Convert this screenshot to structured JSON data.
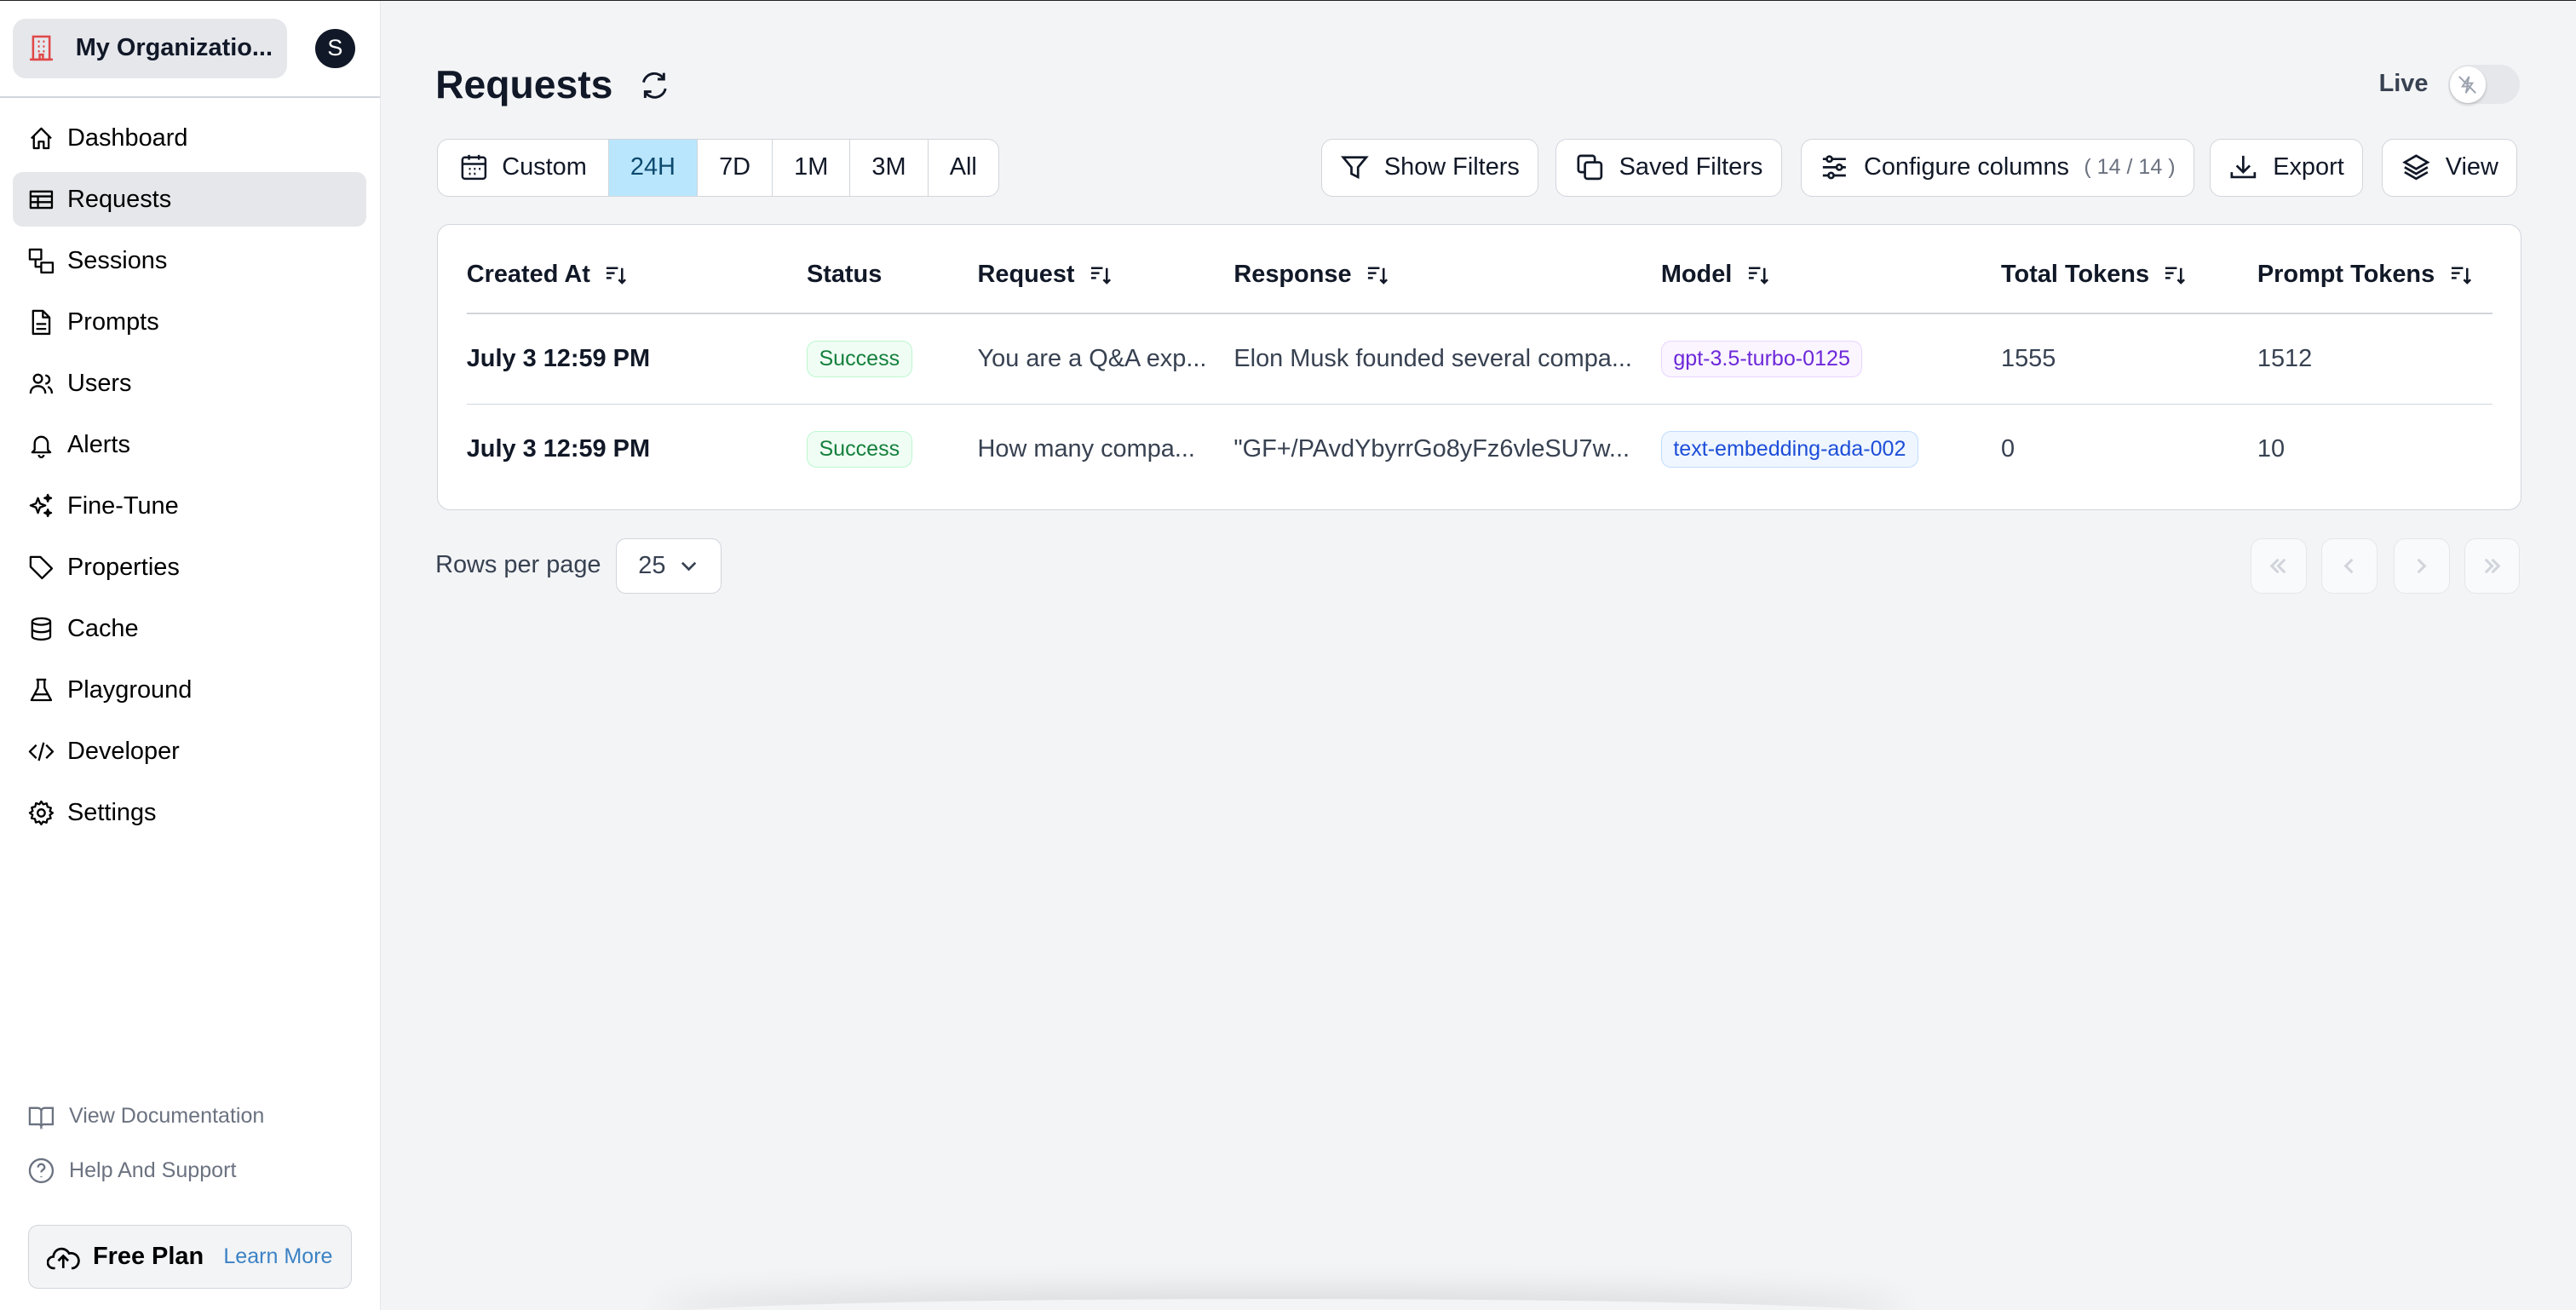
{
  "sidebar": {
    "org_name": "My Organizatio...",
    "avatar_initial": "S",
    "items": [
      {
        "label": "Dashboard",
        "icon": "home-icon"
      },
      {
        "label": "Requests",
        "icon": "table-icon",
        "active": true
      },
      {
        "label": "Sessions",
        "icon": "sessions-icon"
      },
      {
        "label": "Prompts",
        "icon": "document-icon"
      },
      {
        "label": "Users",
        "icon": "users-icon"
      },
      {
        "label": "Alerts",
        "icon": "bell-icon"
      },
      {
        "label": "Fine-Tune",
        "icon": "sparkles-icon"
      },
      {
        "label": "Properties",
        "icon": "tag-icon"
      },
      {
        "label": "Cache",
        "icon": "database-icon"
      },
      {
        "label": "Playground",
        "icon": "beaker-icon"
      },
      {
        "label": "Developer",
        "icon": "code-icon"
      },
      {
        "label": "Settings",
        "icon": "gear-icon"
      }
    ],
    "footer": {
      "docs": "View Documentation",
      "help": "Help And Support",
      "plan": "Free Plan",
      "learn_more": "Learn More"
    }
  },
  "header": {
    "title": "Requests",
    "live_label": "Live",
    "live_on": false
  },
  "toolbar": {
    "ranges": [
      "Custom",
      "24H",
      "7D",
      "1M",
      "3M",
      "All"
    ],
    "selected_range": "24H",
    "show_filters": "Show Filters",
    "saved_filters": "Saved Filters",
    "configure_columns": "Configure columns",
    "columns_count": "( 14 / 14 )",
    "export": "Export",
    "view": "View"
  },
  "table": {
    "columns": [
      "Created At",
      "Status",
      "Request",
      "Response",
      "Model",
      "Total Tokens",
      "Prompt Tokens"
    ],
    "rows": [
      {
        "created_at": "July 3 12:59 PM",
        "status": "Success",
        "request": "You are a Q&A exp...",
        "response": "Elon Musk founded several compa...",
        "model": "gpt-3.5-turbo-0125",
        "total_tokens": "1555",
        "prompt_tokens": "1512"
      },
      {
        "created_at": "July 3 12:59 PM",
        "status": "Success",
        "request": "How many compa...",
        "response": "\"GF+/PAvdYbyrrGo8yFz6vleSU7w...",
        "model": "text-embedding-ada-002",
        "total_tokens": "0",
        "prompt_tokens": "10"
      }
    ]
  },
  "pagination": {
    "rows_per_page_label": "Rows per page",
    "rows_per_page": "25"
  },
  "colors": {
    "accent_selected": "#bae6fd",
    "success": "#15803d",
    "model_purple": "#6d28d9",
    "model_blue": "#1d4ed8",
    "link": "#3b82c4"
  }
}
